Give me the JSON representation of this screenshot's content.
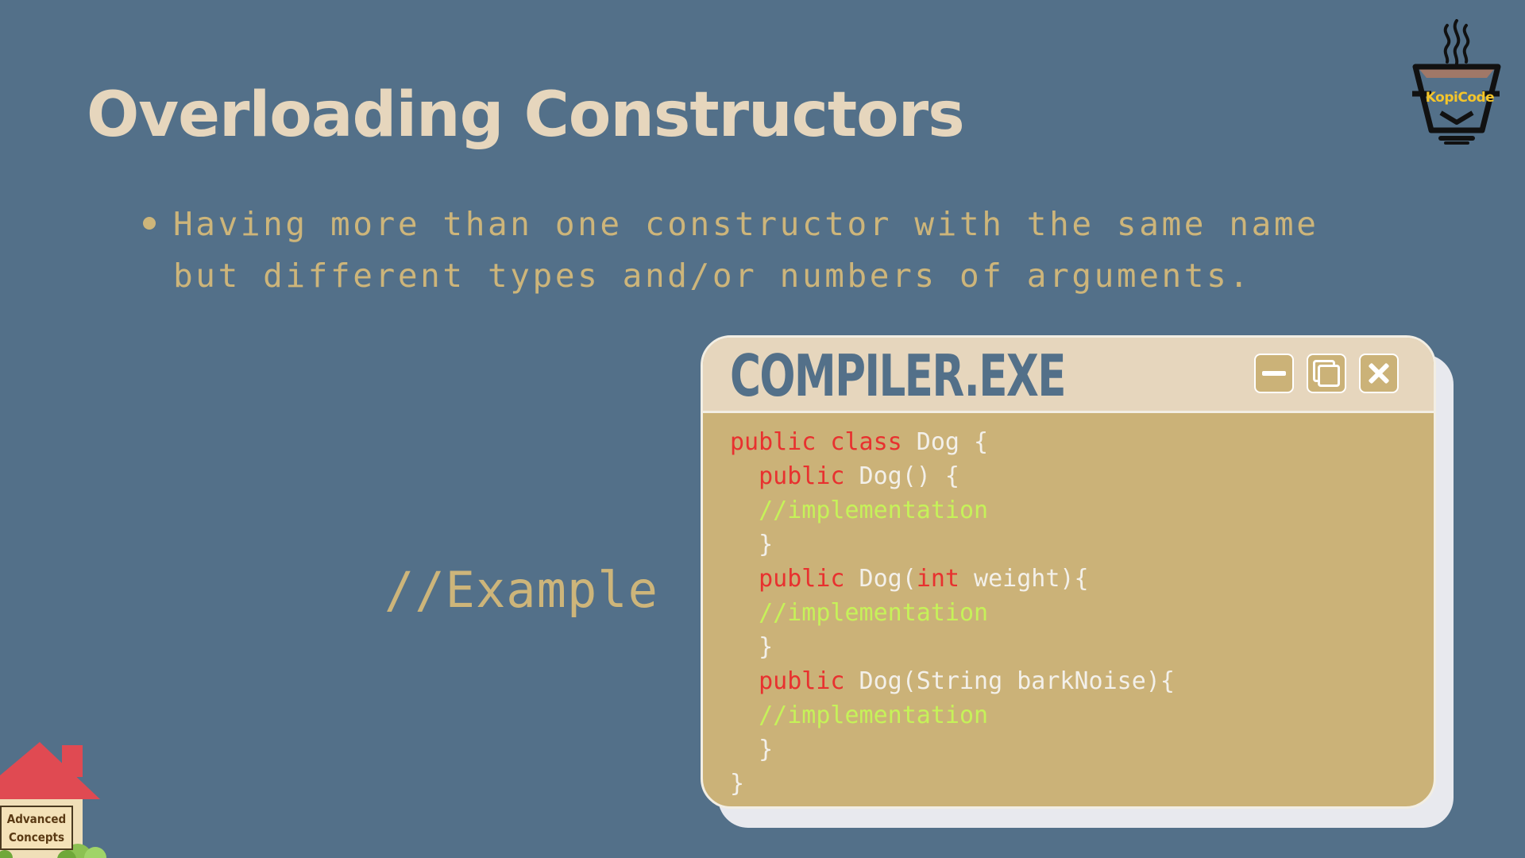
{
  "slide": {
    "title": "Overloading Constructors",
    "bullets": [
      "Having more than one constructor with the same name but different types and/or numbers of arguments."
    ],
    "example_label": "//Example"
  },
  "window": {
    "title": "COMPILER.EXE",
    "buttons": [
      "minimize-icon",
      "maximize-icon",
      "close-icon"
    ],
    "code": [
      [
        {
          "t": "public class",
          "k": "kw"
        },
        {
          "t": " Dog {",
          "k": "tx"
        }
      ],
      [
        {
          "t": "  public",
          "k": "kw"
        },
        {
          "t": " Dog() {",
          "k": "tx"
        }
      ],
      [
        {
          "t": "  //implementation",
          "k": "cm"
        }
      ],
      [
        {
          "t": "  }",
          "k": "tx"
        }
      ],
      [
        {
          "t": "  public",
          "k": "kw"
        },
        {
          "t": " Dog(",
          "k": "tx"
        },
        {
          "t": "int",
          "k": "kw"
        },
        {
          "t": " weight){",
          "k": "tx"
        }
      ],
      [
        {
          "t": "  //implementation",
          "k": "cm"
        }
      ],
      [
        {
          "t": "  }",
          "k": "tx"
        }
      ],
      [
        {
          "t": "  public",
          "k": "kw"
        },
        {
          "t": " Dog(String barkNoise){",
          "k": "tx"
        }
      ],
      [
        {
          "t": "  //implementation",
          "k": "cm"
        }
      ],
      [
        {
          "t": "  }",
          "k": "tx"
        }
      ],
      [
        {
          "t": "}",
          "k": "tx"
        }
      ]
    ]
  },
  "logo": {
    "text": "KopiCode",
    "icon": "coffee-cup-icon"
  },
  "house_sign": {
    "line1": "Advanced",
    "line2": "Concepts",
    "icon": "house-icon"
  },
  "colors": {
    "background": "#537089",
    "title": "#e6d6bd",
    "accent": "#cdb57a",
    "code_keyword": "#e8312f",
    "code_text": "#f3f0ea",
    "code_comment": "#c6f259"
  }
}
